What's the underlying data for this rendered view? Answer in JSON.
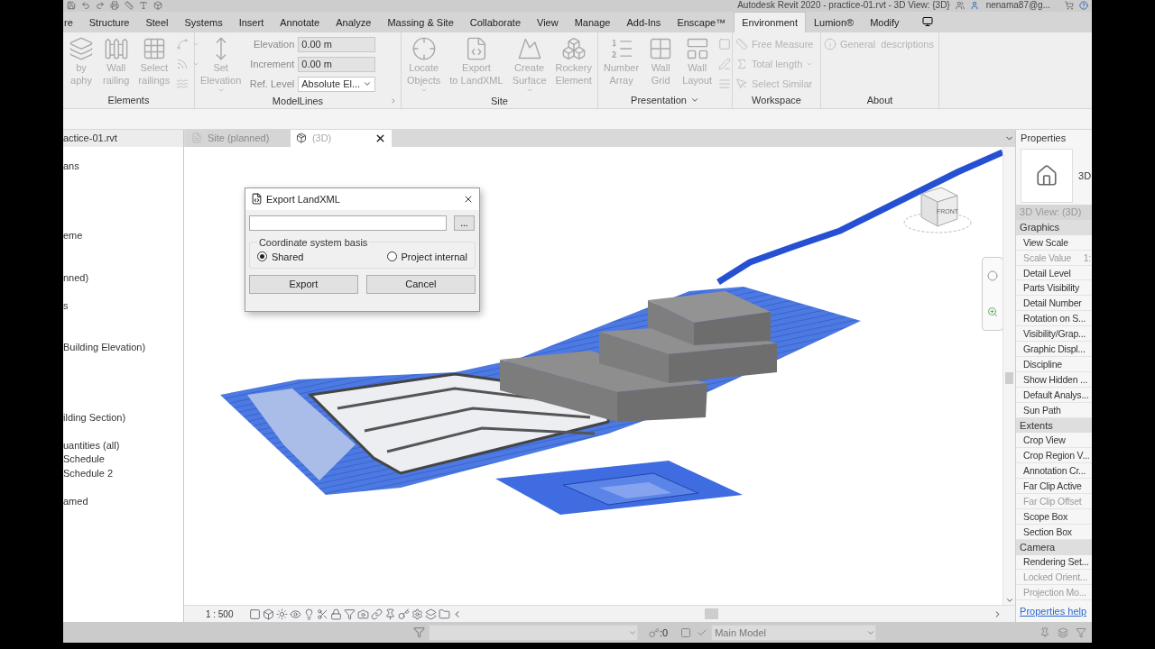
{
  "window": {
    "title": "Autodesk Revit 2020 - practice-01.rvt - 3D View: {3D}",
    "user": "nenama87@g..."
  },
  "ribbon_tabs": [
    {
      "label": "re",
      "selected": false
    },
    {
      "label": "Structure",
      "selected": false
    },
    {
      "label": "Steel",
      "selected": false
    },
    {
      "label": "Systems",
      "selected": false
    },
    {
      "label": "Insert",
      "selected": false
    },
    {
      "label": "Annotate",
      "selected": false
    },
    {
      "label": "Analyze",
      "selected": false
    },
    {
      "label": "Massing & Site",
      "selected": false
    },
    {
      "label": "Collaborate",
      "selected": false
    },
    {
      "label": "View",
      "selected": false
    },
    {
      "label": "Manage",
      "selected": false
    },
    {
      "label": "Add-Ins",
      "selected": false
    },
    {
      "label": "Enscape™",
      "selected": false
    },
    {
      "label": "Environment",
      "selected": true
    },
    {
      "label": "Lumion®",
      "selected": false
    },
    {
      "label": "Modify",
      "selected": false
    }
  ],
  "ribbon_panels": [
    {
      "title": "Elements",
      "tools": [
        {
          "kind": "large",
          "lines": [
            "by",
            "aphy"
          ],
          "disabled": true,
          "menu": false
        },
        {
          "kind": "large",
          "lines": [
            "Wall",
            "railing"
          ],
          "disabled": true,
          "menu": false
        },
        {
          "kind": "large",
          "lines": [
            "Select",
            "railings"
          ],
          "disabled": true,
          "menu": false
        },
        {
          "kind": "stack",
          "items": [
            {
              "kind": "icon",
              "disabled": true,
              "menu": true
            },
            {
              "kind": "icon",
              "disabled": true,
              "menu": true
            },
            {
              "kind": "icon",
              "disabled": true,
              "menu": false
            }
          ]
        }
      ]
    },
    {
      "title": "ModelLines",
      "launcher": true,
      "tools": [
        {
          "kind": "large",
          "lines": [
            "Set",
            "Elevation"
          ],
          "disabled": true,
          "menu": true
        },
        {
          "kind": "stack",
          "items": [
            {
              "kind": "field",
              "label": "Elevation",
              "value": "0.00 m",
              "disabled": true
            },
            {
              "kind": "field",
              "label": "Increment",
              "value": "0.00 m",
              "disabled": true
            },
            {
              "kind": "select",
              "label": "Ref. Level",
              "value": "Absolute El...",
              "disabled": false
            }
          ]
        }
      ]
    },
    {
      "title": "Site",
      "tools": [
        {
          "kind": "large",
          "lines": [
            "Locate",
            "Objects"
          ],
          "disabled": true,
          "menu": true
        },
        {
          "kind": "large",
          "lines": [
            "Export",
            "to LandXML"
          ],
          "disabled": true,
          "menu": false
        },
        {
          "kind": "large",
          "lines": [
            "Create",
            "Surface"
          ],
          "disabled": true,
          "menu": true
        },
        {
          "kind": "large",
          "lines": [
            "Rockery",
            "Element"
          ],
          "disabled": true,
          "menu": false
        }
      ]
    },
    {
      "title": "Presentation",
      "menu": true,
      "tools": [
        {
          "kind": "large",
          "lines": [
            "Number",
            "Array"
          ],
          "disabled": true,
          "menu": false
        },
        {
          "kind": "large",
          "lines": [
            "Wall",
            "Grid"
          ],
          "disabled": true,
          "menu": false
        },
        {
          "kind": "large",
          "lines": [
            "Wall",
            "Layout"
          ],
          "disabled": true,
          "menu": false
        },
        {
          "kind": "stack",
          "items": [
            {
              "kind": "icon",
              "disabled": true,
              "menu": false
            },
            {
              "kind": "icon",
              "disabled": true,
              "menu": false
            },
            {
              "kind": "icon",
              "disabled": true,
              "menu": false
            }
          ]
        }
      ]
    },
    {
      "title": "Workspace",
      "tools": [
        {
          "kind": "stack",
          "items": [
            {
              "kind": "small",
              "label": "Free Measure",
              "disabled": true,
              "menu": false
            },
            {
              "kind": "small",
              "label": "Total length",
              "disabled": true,
              "menu": true
            },
            {
              "kind": "small",
              "label": "Select Similar",
              "disabled": true,
              "menu": false
            }
          ]
        }
      ]
    },
    {
      "title": "About",
      "tools": [
        {
          "kind": "stack",
          "items": [
            {
              "kind": "small",
              "label": "General  descriptions",
              "disabled": true,
              "menu": false
            }
          ]
        }
      ]
    }
  ],
  "project_browser": {
    "file": "actice-01.rvt",
    "items": [
      "ans",
      "eme",
      "nned)",
      "s",
      "Building Elevation)",
      "ilding Section)",
      "uantities (all)",
      "Schedule",
      "Schedule 2",
      "amed"
    ]
  },
  "view_tabs": [
    {
      "label": "Site (planned)",
      "selected": false
    },
    {
      "label": "(3D)",
      "selected": true
    }
  ],
  "view_cube": {
    "face": "FRONT"
  },
  "dialog": {
    "title": "Export LandXML",
    "browse": "...",
    "group": "Coordinate system basis",
    "options": [
      {
        "label": "Shared",
        "selected": true
      },
      {
        "label": "Project internal",
        "selected": false
      }
    ],
    "buttons": [
      "Export",
      "Cancel"
    ]
  },
  "view_control_bar": {
    "scale": "1 : 500"
  },
  "properties": {
    "title": "Properties",
    "type_label": "3D",
    "view_selector": "3D View: (3D)",
    "groups": [
      {
        "name": "Graphics",
        "rows": [
          {
            "label": "View Scale",
            "disabled": false
          },
          {
            "label": "Scale Value",
            "value": "1:",
            "disabled": true
          },
          {
            "label": "Detail Level",
            "disabled": false
          },
          {
            "label": "Parts Visibility",
            "disabled": false
          },
          {
            "label": "Detail Number",
            "disabled": false
          },
          {
            "label": "Rotation on S...",
            "disabled": false
          },
          {
            "label": "Visibility/Grap...",
            "disabled": false
          },
          {
            "label": "Graphic Displ...",
            "disabled": false
          },
          {
            "label": "Discipline",
            "disabled": false
          },
          {
            "label": "Show Hidden ...",
            "disabled": false
          },
          {
            "label": "Default Analys...",
            "disabled": false
          },
          {
            "label": "Sun Path",
            "disabled": false
          }
        ]
      },
      {
        "name": "Extents",
        "rows": [
          {
            "label": "Crop View",
            "disabled": false
          },
          {
            "label": "Crop Region V...",
            "disabled": false
          },
          {
            "label": "Annotation Cr...",
            "disabled": false
          },
          {
            "label": "Far Clip Active",
            "disabled": false
          },
          {
            "label": "Far Clip Offset",
            "disabled": true
          },
          {
            "label": "Scope Box",
            "disabled": false
          },
          {
            "label": "Section Box",
            "disabled": false
          }
        ]
      },
      {
        "name": "Camera",
        "rows": [
          {
            "label": "Rendering Set...",
            "disabled": false
          },
          {
            "label": "Locked Orient...",
            "disabled": true
          },
          {
            "label": "Projection Mo...",
            "disabled": true
          }
        ]
      }
    ],
    "help_link": "Properties help"
  },
  "status_bar": {
    "count": ":0",
    "model": "Main Model"
  }
}
